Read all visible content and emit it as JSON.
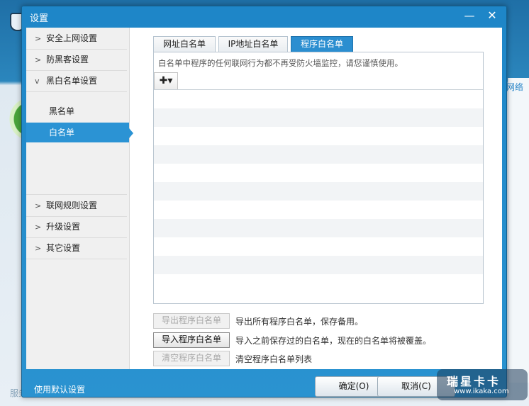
{
  "dialog": {
    "title": "设置",
    "minimize_glyph": "—",
    "close_glyph": "✕"
  },
  "sidebar": {
    "items": [
      {
        "label": "安全上网设置",
        "expanded": false
      },
      {
        "label": "防黑客设置",
        "expanded": false
      },
      {
        "label": "黑白名单设置",
        "expanded": true
      },
      {
        "label": "联网规则设置",
        "expanded": false
      },
      {
        "label": "升级设置",
        "expanded": false
      },
      {
        "label": "其它设置",
        "expanded": false
      }
    ],
    "subitems": [
      {
        "label": "黑名单",
        "active": false
      },
      {
        "label": "白名单",
        "active": true
      }
    ]
  },
  "tabs": [
    {
      "label": "网址白名单",
      "active": false
    },
    {
      "label": "IP地址白名单",
      "active": false
    },
    {
      "label": "程序白名单",
      "active": true
    }
  ],
  "panel": {
    "hint": "白名单中程序的任何联网行为都不再受防火墙监控，请您谨慎使用。",
    "add_glyph": "✚▾",
    "row_count": 11
  },
  "actions": [
    {
      "label": "导出程序白名单",
      "enabled": false,
      "desc": "导出所有程序白名单，保存备用。"
    },
    {
      "label": "导入程序白名单",
      "enabled": true,
      "desc": "导入之前保存过的白名单，现在的白名单将被覆盖。"
    },
    {
      "label": "清空程序白名单",
      "enabled": false,
      "desc": "清空程序白名单列表"
    }
  ],
  "footer": {
    "reset_link": "使用默认设置",
    "ok": "确定(O)",
    "cancel": "取消(C)"
  },
  "background": {
    "right_label": "网络",
    "bottom_label": "服务"
  },
  "watermark": {
    "title": "瑞星卡卡",
    "url": "www.ikaka.com"
  },
  "colors": {
    "accent": "#2b93d4",
    "title_bar": "#1e86c8",
    "row_alt": "#f2f4f6"
  }
}
